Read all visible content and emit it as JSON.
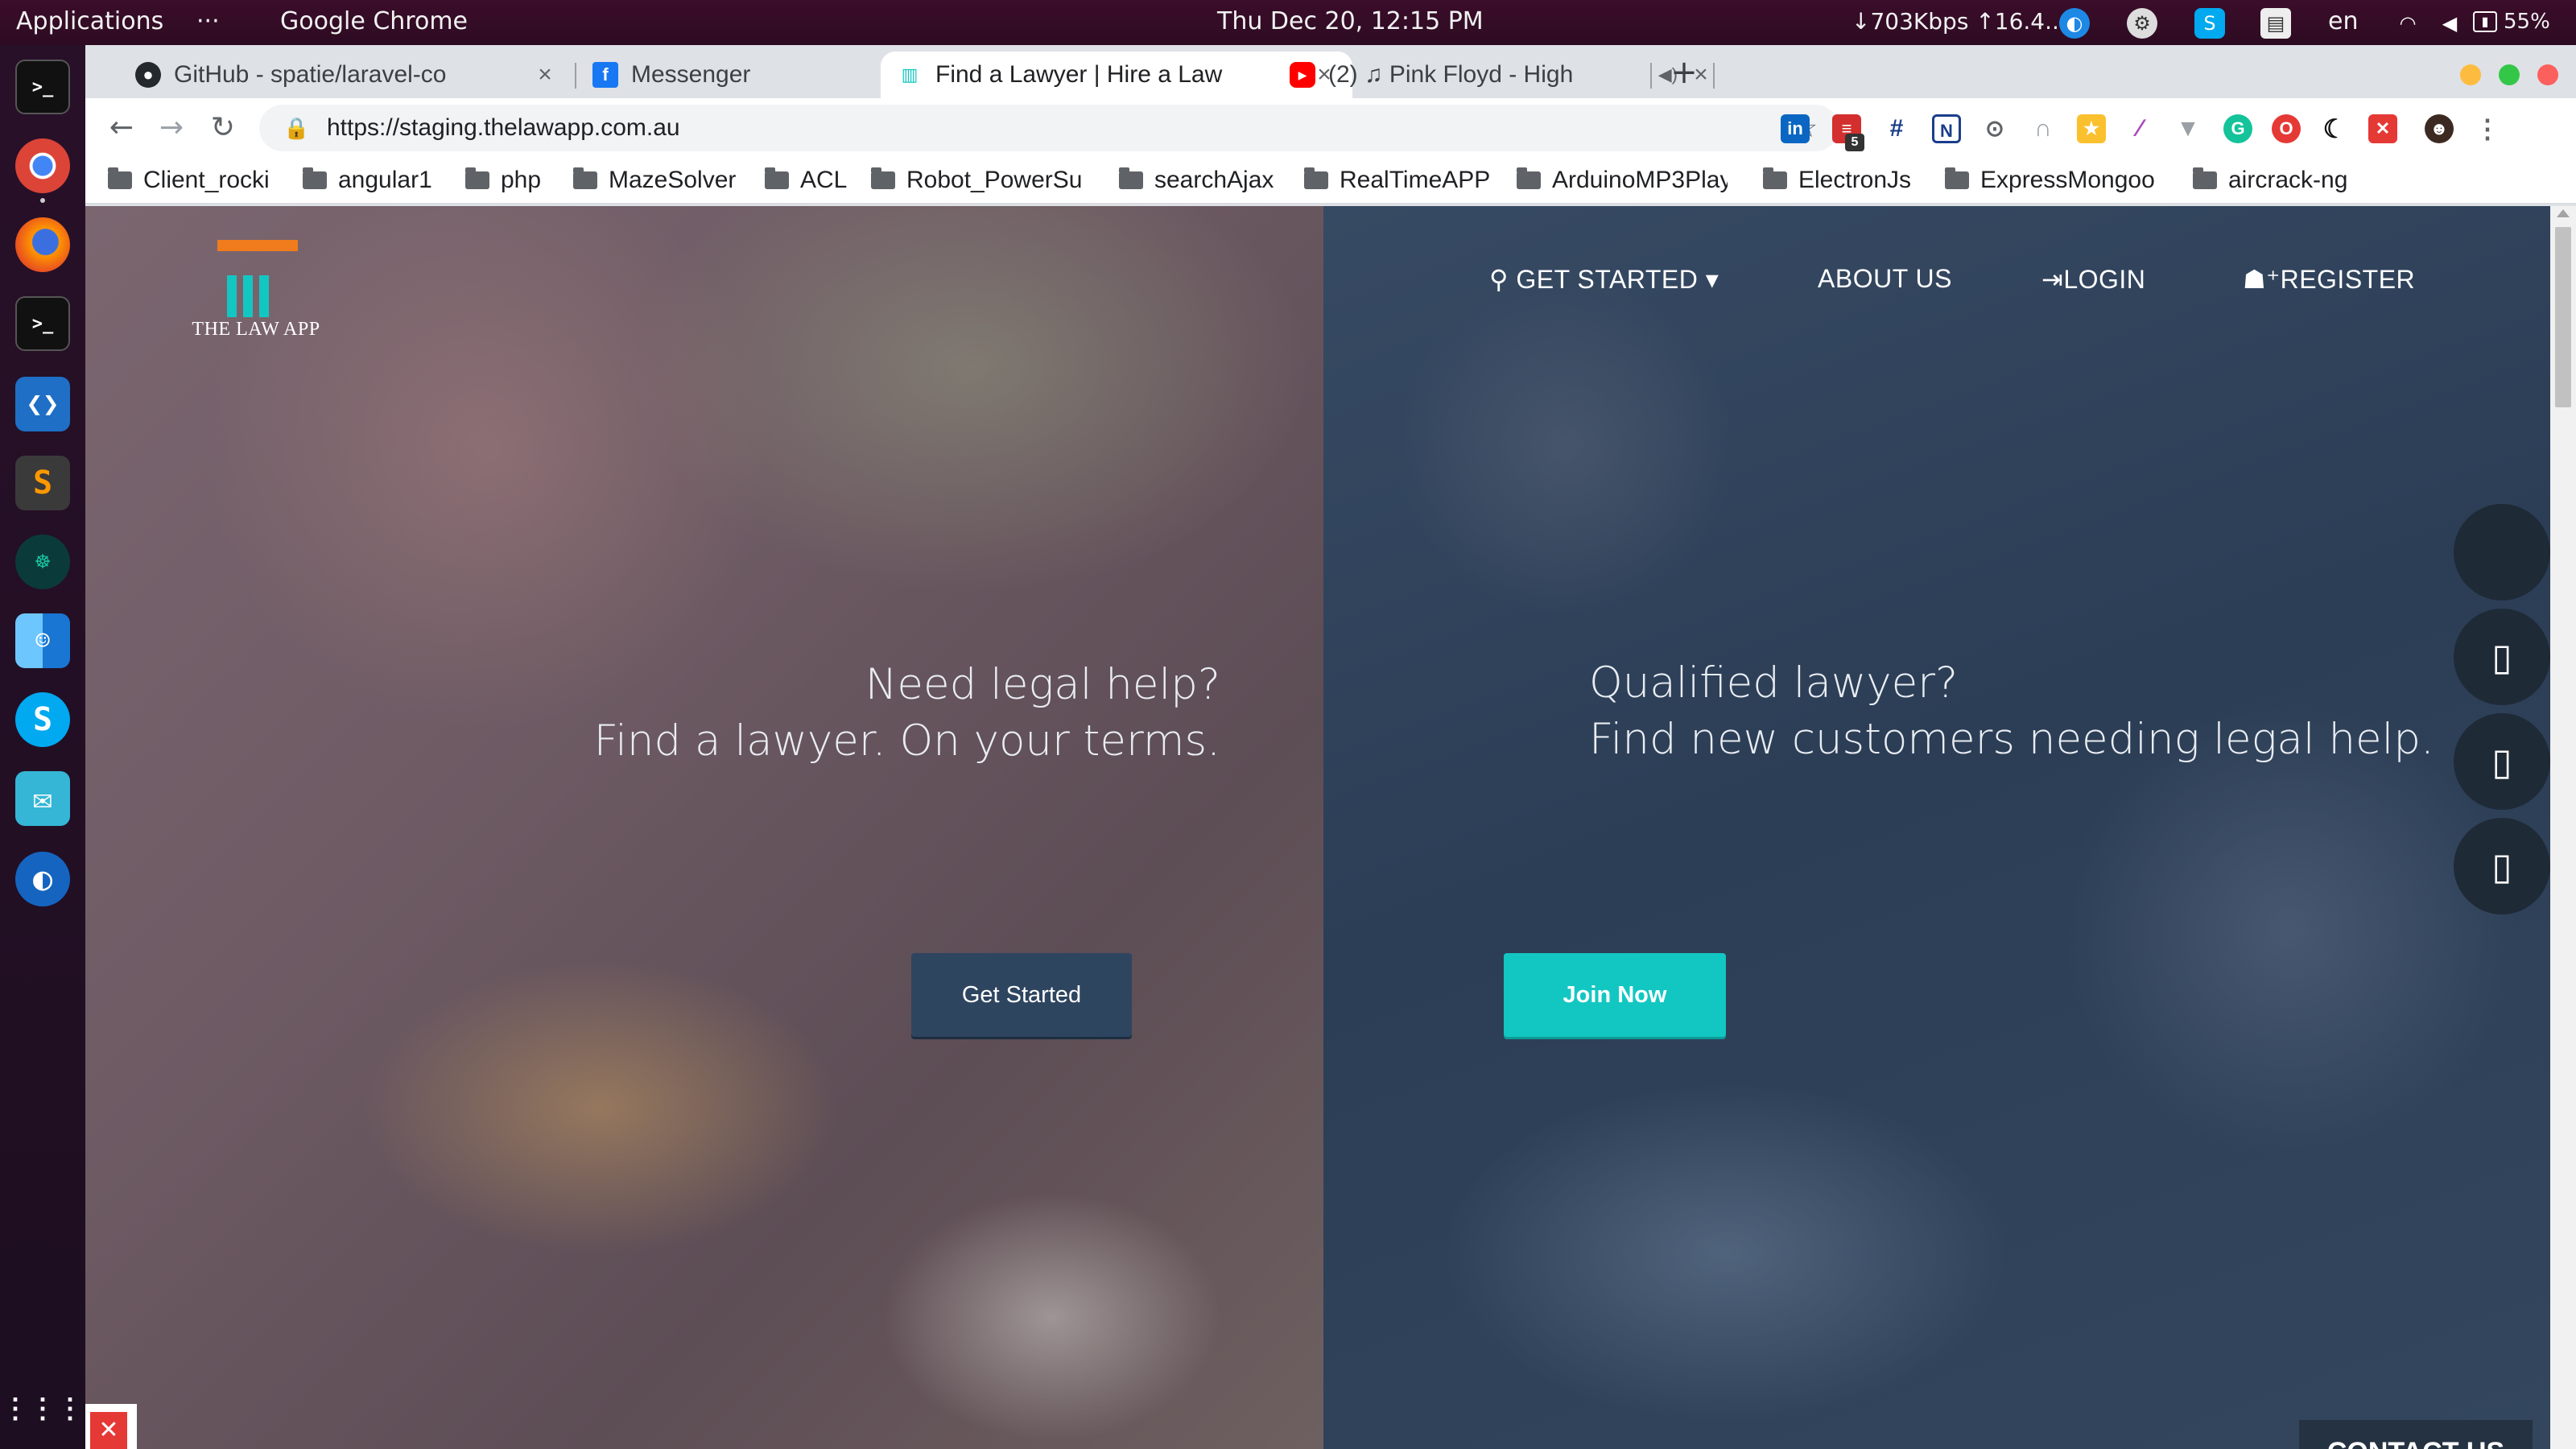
{
  "topbar": {
    "applications": "Applications",
    "dots": "···",
    "app_name": "Google Chrome",
    "clock": "Thu Dec 20, 12:15 PM",
    "net_speed": "↓703Kbps ↑16.4...",
    "lang": "en",
    "battery": "55%"
  },
  "dock": {
    "apps": [
      "terminal-icon",
      "chrome-icon",
      "firefox-icon",
      "terminal-icon",
      "vscode-icon",
      "sublime-icon",
      "gitkraken-icon",
      "finder-icon",
      "skype-icon",
      "mail-icon",
      "web-app-icon",
      "app-grid-icon"
    ]
  },
  "tabs": [
    {
      "title": "GitHub - spatie/laravel-co",
      "icon": "github-icon",
      "active": false
    },
    {
      "title": "Messenger",
      "icon": "facebook-icon",
      "active": false
    },
    {
      "title": "Find a Lawyer | Hire a Law",
      "icon": "lawapp-icon",
      "active": true
    },
    {
      "title": "(2) ♫ Pink Floyd - High",
      "icon": "youtube-icon",
      "active": false
    }
  ],
  "toolbar": {
    "url": "https://staging.thelawapp.com.au",
    "extension_badge": "5"
  },
  "bookmarks": [
    "Client_rocki",
    "angular1",
    "php",
    "MazeSolver",
    "ACL",
    "Robot_PowerSu",
    "searchAjax",
    "RealTimeAPP",
    "ArduinoMP3Play",
    "ElectronJs",
    "ExpressMongoo",
    "aircrack-ng"
  ],
  "site": {
    "logo_text": "THE LAW APP",
    "nav": {
      "get_started": "GET STARTED",
      "about": "ABOUT US",
      "login": "LOGIN",
      "register": "REGISTER"
    },
    "left": {
      "line1": "Need legal help?",
      "line2": "Find a lawyer. On your terms.",
      "button": "Get Started"
    },
    "right": {
      "line1": "Qualified lawyer?",
      "line2": "Find new customers needing legal help.",
      "button": "Join Now"
    },
    "contact": "CONTACT US"
  },
  "colors": {
    "accent_teal": "#12c7c2",
    "accent_orange": "#f07b1d",
    "navy": "#2e4560"
  }
}
